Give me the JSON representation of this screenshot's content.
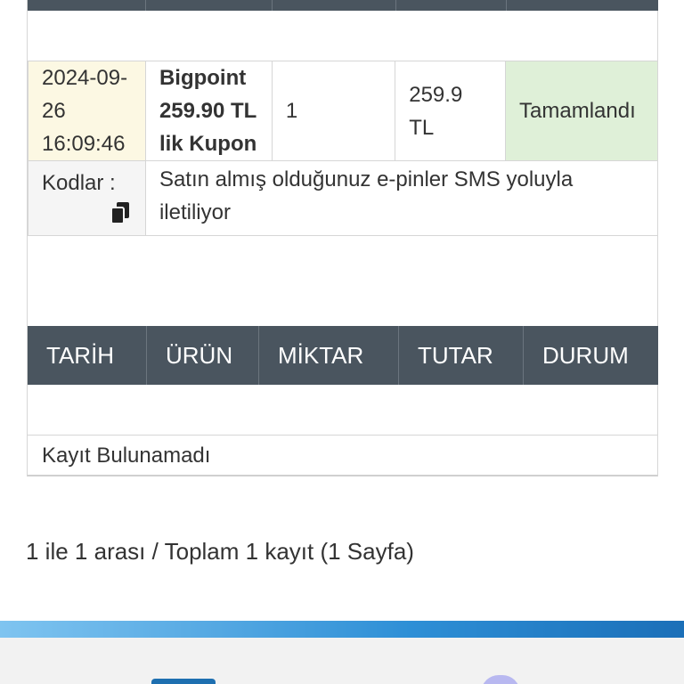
{
  "order": {
    "date": "2024-09-26 16:09:46",
    "product": "Bigpoint 259.90 TL lik Kupon",
    "quantity": "1",
    "amount": "259.9 TL",
    "status": "Tamamlandı",
    "codes_label": "Kodlar :",
    "codes_message": "Satın almış olduğunuz e-pinler SMS yoluyla iletiliyor"
  },
  "list": {
    "columns": [
      "TARİH",
      "ÜRÜN",
      "MİKTAR",
      "TUTAR",
      "DURUM"
    ],
    "empty_text": "Kayıt Bulunamadı"
  },
  "pagination": {
    "summary": "1 ile 1 arası / Toplam 1 kayıt (1 Sayfa)"
  },
  "colors": {
    "header_bg": "#4a555f",
    "date_bg": "#fcf8e3",
    "status_bg": "#dff0d8",
    "band": "#2e8fd6"
  },
  "icons": {
    "copy": "copy-icon"
  }
}
